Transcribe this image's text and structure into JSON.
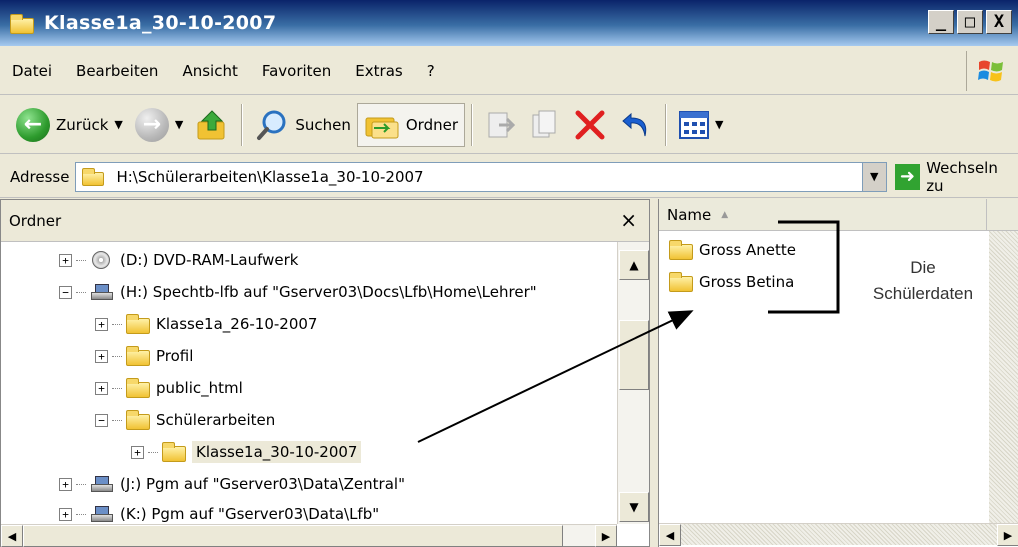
{
  "window": {
    "title": "Klasse1a_30-10-2007",
    "buttons": {
      "minimize": "_",
      "maximize": "□",
      "close": "X"
    }
  },
  "menubar": {
    "items": [
      "Datei",
      "Bearbeiten",
      "Ansicht",
      "Favoriten",
      "Extras",
      "?"
    ]
  },
  "toolbar": {
    "back_label": "Zurück",
    "search_label": "Suchen",
    "folders_label": "Ordner",
    "icons": [
      "back-icon",
      "forward-icon",
      "up-folder-icon",
      "search-icon",
      "folders-icon",
      "move-to-icon",
      "copy-to-icon",
      "delete-icon",
      "undo-icon",
      "views-icon"
    ]
  },
  "address": {
    "label": "Adresse",
    "value": "H:\\Schülerarbeiten\\Klasse1a_30-10-2007",
    "go_label": "Wechseln zu"
  },
  "folder_pane": {
    "title": "Ordner",
    "close": "×",
    "tree": [
      {
        "label": "(D:) DVD-RAM-Laufwerk",
        "icon": "dvd-drive-icon",
        "expander": "+"
      },
      {
        "label": "(H:) Spechtb-lfb auf \"Gserver03\\Docs\\Lfb\\Home\\Lehrer\"",
        "icon": "network-drive-icon",
        "expander": "−"
      },
      {
        "label": "Klasse1a_26-10-2007",
        "icon": "folder-icon",
        "expander": "+"
      },
      {
        "label": "Profil",
        "icon": "folder-icon",
        "expander": "+"
      },
      {
        "label": "public_html",
        "icon": "folder-icon",
        "expander": "+"
      },
      {
        "label": "Schülerarbeiten",
        "icon": "folder-icon",
        "expander": "−"
      },
      {
        "label": "Klasse1a_30-10-2007",
        "icon": "folder-icon",
        "expander": "+",
        "selected": true
      },
      {
        "label": "(J:) Pgm auf \"Gserver03\\Data\\Zentral\"",
        "icon": "network-drive-icon",
        "expander": "+"
      },
      {
        "label": "(K:) Pgm auf \"Gserver03\\Data\\Lfb\"",
        "icon": "network-drive-icon",
        "expander": "+"
      }
    ]
  },
  "content_pane": {
    "column_name": "Name",
    "items": [
      "Gross Anette",
      "Gross Betina"
    ]
  },
  "annotation": {
    "line1": "Die",
    "line2": "Schülerdaten"
  },
  "colors": {
    "title_bar": "#0a246a",
    "chrome": "#ece9d8",
    "delete_red": "#e02020",
    "undo_blue": "#1a5fd0"
  }
}
